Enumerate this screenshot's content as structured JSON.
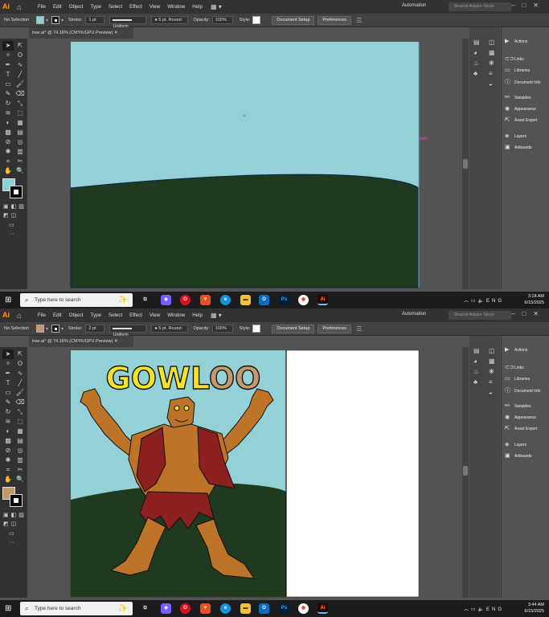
{
  "app": {
    "logo": "Ai",
    "menu": [
      "File",
      "Edit",
      "Object",
      "Type",
      "Select",
      "Effect",
      "View",
      "Window",
      "Help"
    ],
    "workspace_label": "Automation",
    "search_placeholder": "Search Adobe Stock",
    "window_controls": [
      "–",
      "□",
      "✕"
    ]
  },
  "control": {
    "selection": "No Selection",
    "stroke_label": "Stroke:",
    "opacity_label": "Opacity:",
    "opacity_value": "100%",
    "style_label": "Style:",
    "brush_profile": "Uniform",
    "brush": "5 pt. Round",
    "document_setup": "Document Setup",
    "preferences": "Preferences"
  },
  "panel": {
    "items": [
      "Actions",
      "Links",
      "Libraries",
      "Document Info",
      "Variables",
      "Appearance",
      "Asset Export",
      "Layers",
      "Artboards"
    ]
  },
  "taskbar": {
    "search_placeholder": "Type here to search",
    "lang": "ENG",
    "date": "6/15/2025"
  },
  "screens": [
    {
      "doc_tab": "tree.ai* @ 74.16% (CMYK/GPU Preview)",
      "stroke_weight": "1 pt",
      "fill_color": "#8fd0d4",
      "artboard_hint": "path",
      "time": "3:18 AM"
    },
    {
      "doc_tab": "tree.ai* @ 74.16% (CMYK/GPU Preview)",
      "stroke_weight": "2 pt",
      "fill_color": "#c49a6c",
      "art_title": "GOWLOO",
      "time": "3:44 AM"
    }
  ],
  "colors": {
    "sky": "#94d1d6",
    "ground": "#203a1f",
    "skin": "#bd7429",
    "vest": "#8c1f1f",
    "title_yellow": "#f5e32a",
    "title_tan": "#c49a6c"
  }
}
